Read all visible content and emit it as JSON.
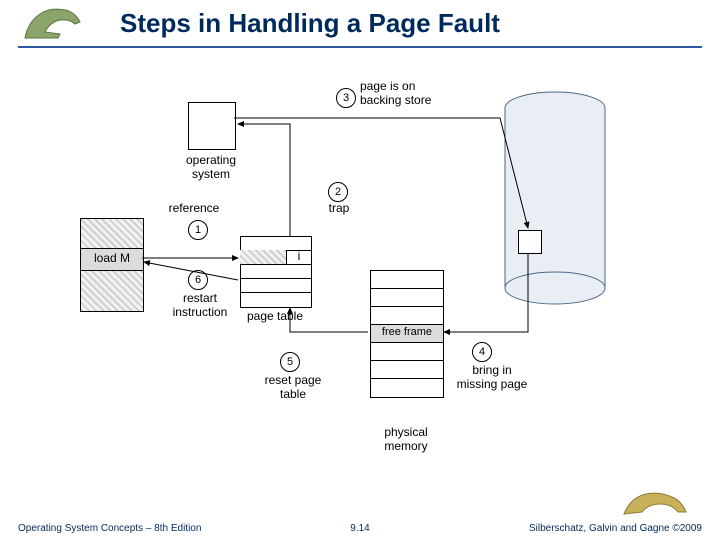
{
  "title": "Steps in Handling a Page Fault",
  "footer": {
    "left": "Operating System Concepts – 8th Edition",
    "center": "9.14",
    "right": "Silberschatz, Galvin and Gagne ©2009"
  },
  "steps": {
    "s1": "1",
    "s2": "2",
    "s3": "3",
    "s4": "4",
    "s5": "5",
    "s6": "6"
  },
  "labels": {
    "os": "operating\nsystem",
    "reference": "reference",
    "trap": "trap",
    "backing": "page is on\nbacking store",
    "loadM": "load M",
    "pageTable": "page table",
    "ptEntry": "i",
    "restart": "restart\ninstruction",
    "resetPT": "reset page\ntable",
    "freeFrame": "free frame",
    "bringIn": "bring in\nmissing page",
    "physMem": "physical\nmemory"
  }
}
